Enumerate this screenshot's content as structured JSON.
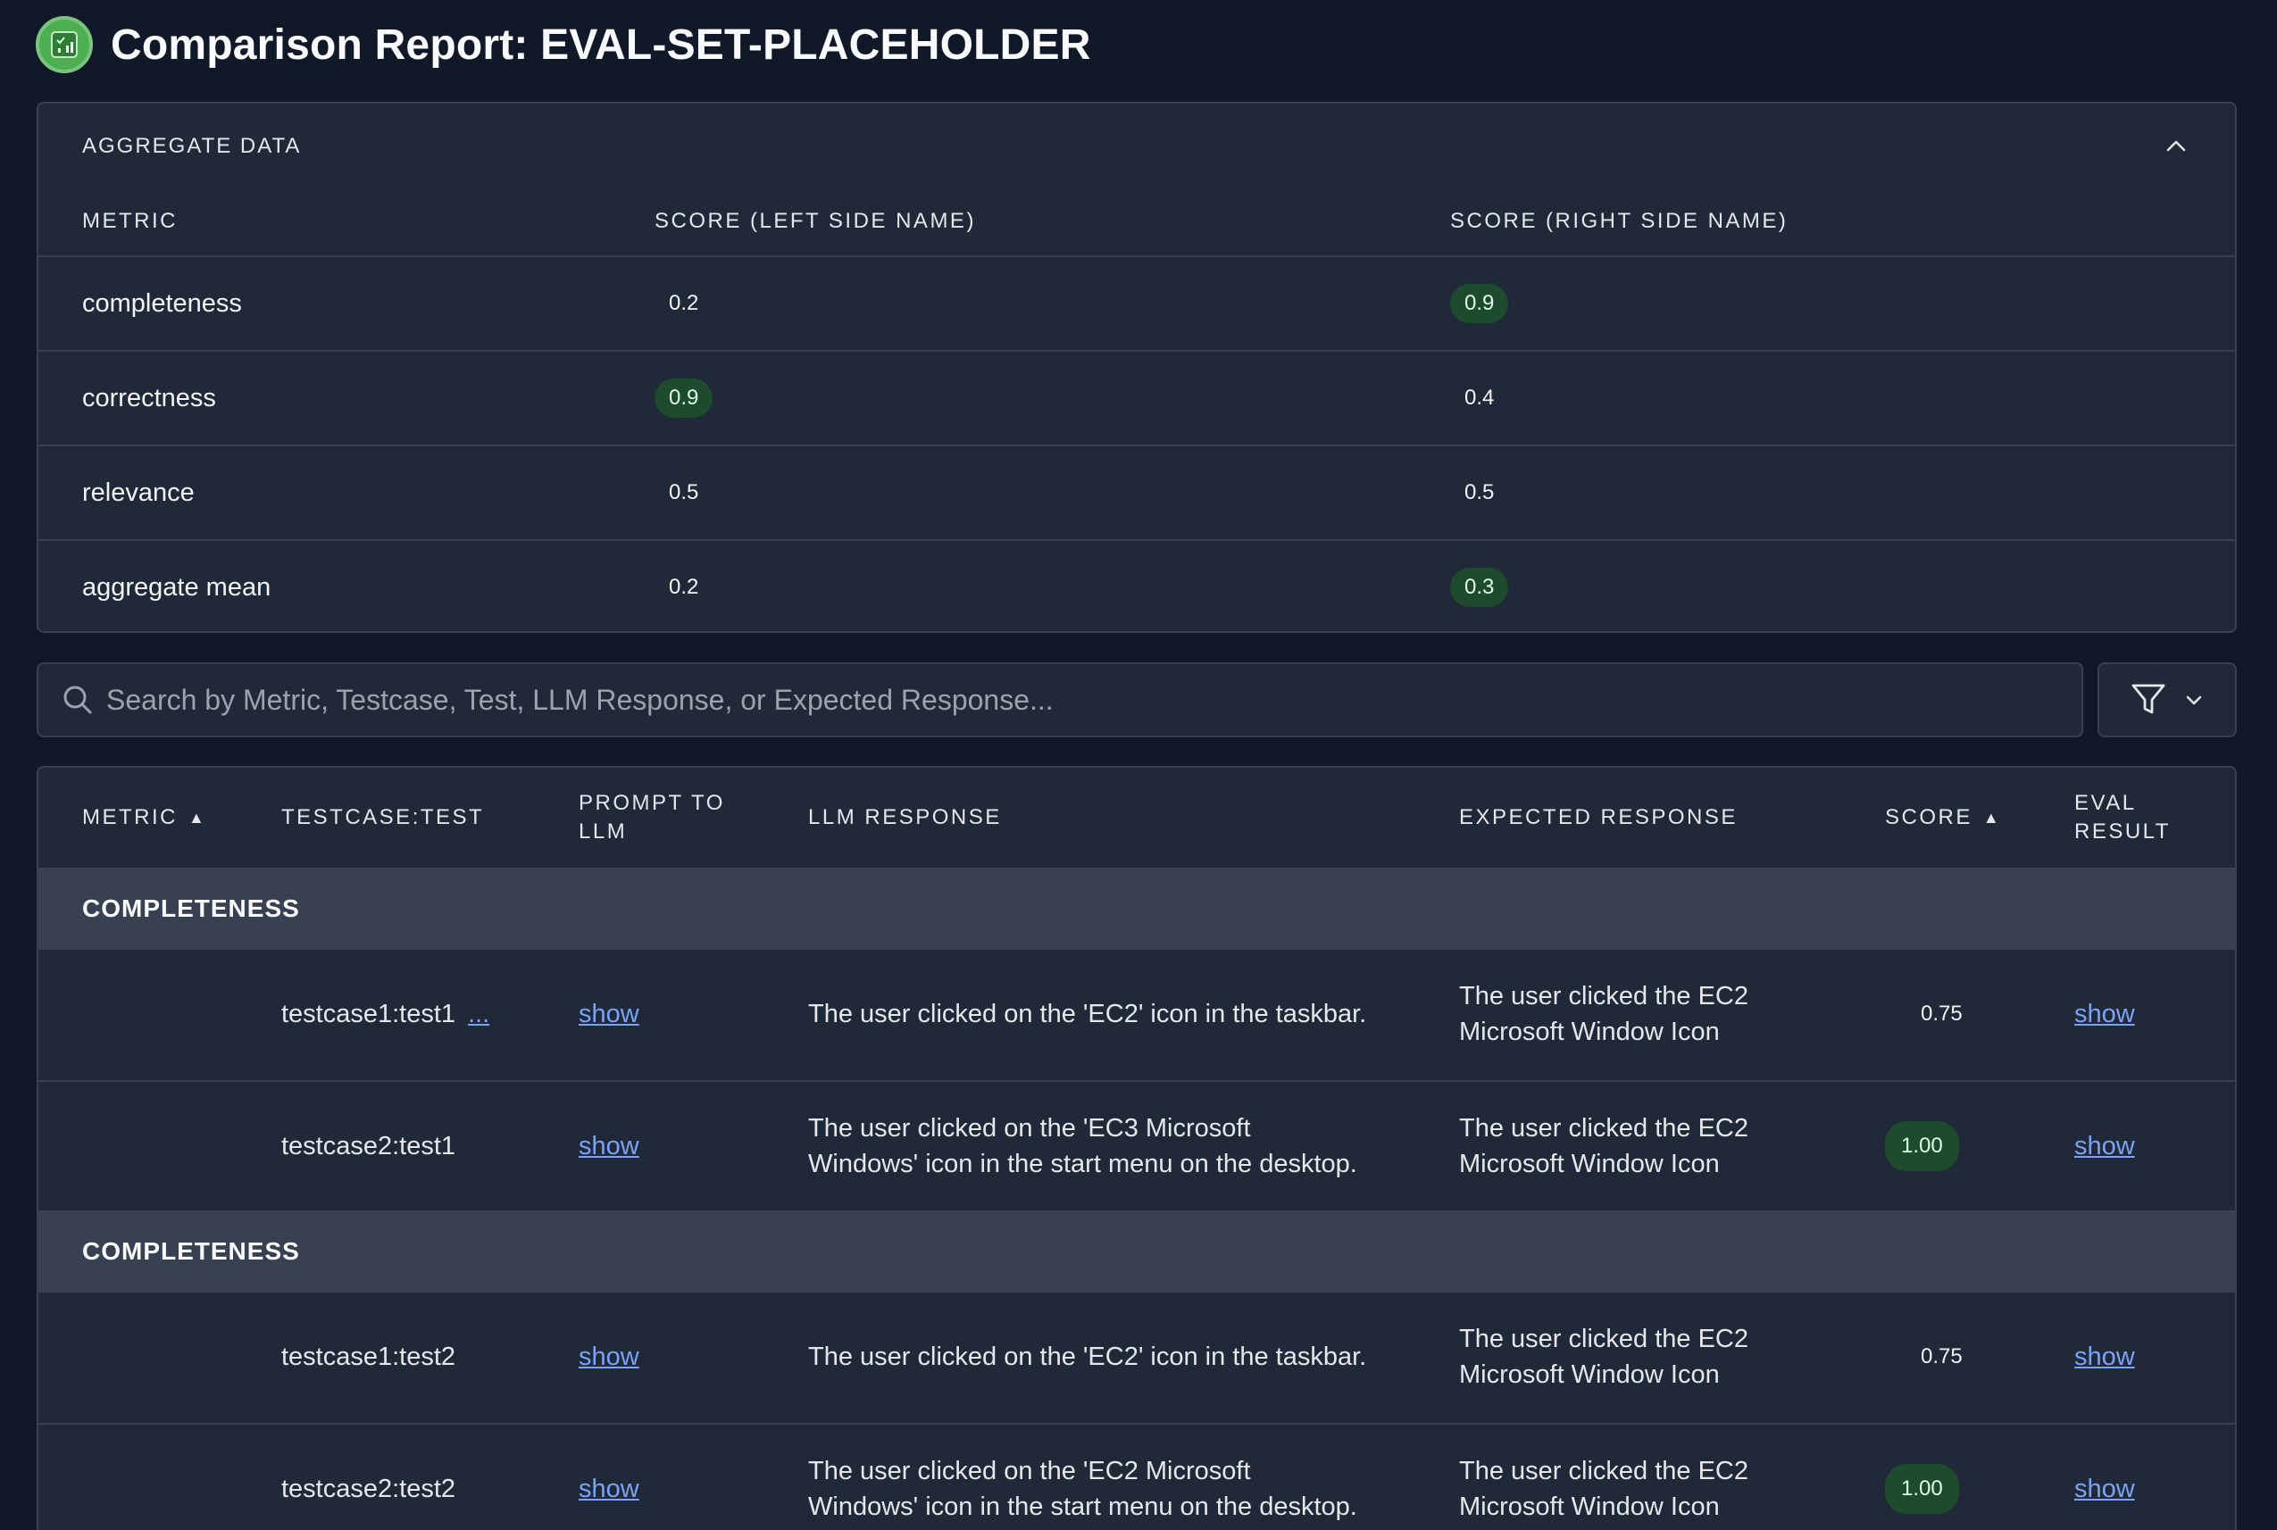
{
  "header": {
    "title": "Comparison Report: EVAL-SET-PLACEHOLDER",
    "logo_icon": "report-chart-icon",
    "logo_color": "#4caf50"
  },
  "aggregate": {
    "title": "AGGREGATE DATA",
    "collapse_icon": "chevron-up-icon",
    "columns": {
      "metric": "METRIC",
      "left": "SCORE (LEFT SIDE NAME)",
      "right": "SCORE (RIGHT SIDE NAME)"
    },
    "rows": [
      {
        "metric": "completeness",
        "left": "0.2",
        "right": "0.9",
        "winner": "right"
      },
      {
        "metric": "correctness",
        "left": "0.9",
        "right": "0.4",
        "winner": "left"
      },
      {
        "metric": "relevance",
        "left": "0.5",
        "right": "0.5",
        "winner": "none"
      },
      {
        "metric": "aggregate mean",
        "left": "0.2",
        "right": "0.3",
        "winner": "right"
      }
    ]
  },
  "search": {
    "placeholder": "Search by Metric, Testcase, Test, LLM Response, or Expected Response...",
    "value": "",
    "icon": "search-icon"
  },
  "filter": {
    "icon": "filter-icon",
    "dropdown_icon": "chevron-down-icon"
  },
  "table": {
    "columns": {
      "metric": "METRIC",
      "metric_sort": "▲",
      "testcase": "TESTCASE:TEST",
      "prompt_1": "PROMPT TO",
      "prompt_2": "LLM",
      "llm": "LLM RESPONSE",
      "expected": "EXPECTED RESPONSE",
      "score": "SCORE",
      "score_sort": "▲",
      "eval_1": "EVAL",
      "eval_2": "RESULT"
    },
    "groups": [
      {
        "label": "COMPLETENESS",
        "rows": [
          {
            "testcase": "testcase1:test1",
            "more": "...",
            "prompt": "show",
            "llm_1": "The user clicked on the 'EC2' icon in the taskbar.",
            "llm_2": "",
            "expected_1": "The user clicked the EC2",
            "expected_2": "Microsoft Window Icon",
            "score": "0.75",
            "score_hi": false,
            "eval": "show"
          },
          {
            "testcase": "testcase2:test1",
            "more": "",
            "prompt": "show",
            "llm_1": "The user clicked on the 'EC3 Microsoft",
            "llm_2": "Windows' icon in the start menu on the desktop.",
            "expected_1": "The user clicked the EC2",
            "expected_2": "Microsoft Window Icon",
            "score": "1.00",
            "score_hi": true,
            "eval": "show"
          }
        ]
      },
      {
        "label": "COMPLETENESS",
        "rows": [
          {
            "testcase": "testcase1:test2",
            "more": "",
            "prompt": "show",
            "llm_1": "The user clicked on the 'EC2' icon in the taskbar.",
            "llm_2": "",
            "expected_1": "The user clicked the EC2",
            "expected_2": "Microsoft Window Icon",
            "score": "0.75",
            "score_hi": false,
            "eval": "show"
          },
          {
            "testcase": "testcase2:test2",
            "more": "",
            "prompt": "show",
            "llm_1": "The user clicked on the 'EC2 Microsoft",
            "llm_2": "Windows' icon in the start menu on the desktop.",
            "expected_1": "The user clicked the EC2",
            "expected_2": "Microsoft Window Icon",
            "score": "1.00",
            "score_hi": true,
            "eval": "show"
          }
        ]
      }
    ]
  }
}
